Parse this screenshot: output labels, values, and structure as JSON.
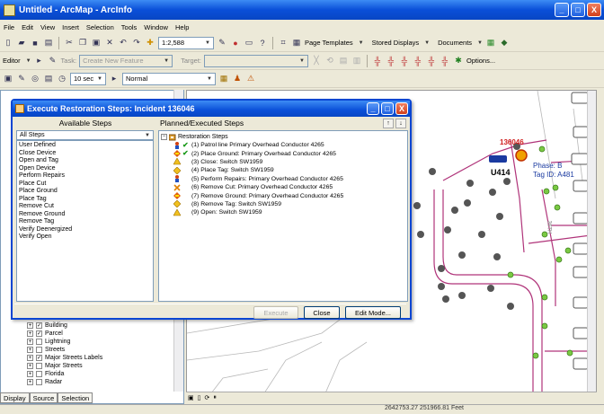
{
  "window": {
    "title": "Untitled - ArcMap - ArcInfo",
    "buttons": [
      "_",
      "□",
      "X"
    ]
  },
  "menu": [
    "File",
    "Edit",
    "View",
    "Insert",
    "Selection",
    "Tools",
    "Window",
    "Help"
  ],
  "toolbar1": {
    "scale": "1:2,588",
    "page_templates": "Page Templates",
    "stored_displays": "Stored Displays",
    "documents": "Documents"
  },
  "toolbar2": {
    "editor": "Editor",
    "task_label": "Task:",
    "task_value": "Create New Feature",
    "target_label": "Target:",
    "options": "Options..."
  },
  "toolbar3": {
    "interval": "10 sec",
    "mode": "Normal"
  },
  "toc": {
    "layers": [
      {
        "label": "Building",
        "checked": true
      },
      {
        "label": "Parcel",
        "checked": true
      },
      {
        "label": "Lightning",
        "checked": false
      },
      {
        "label": "Streets",
        "checked": false
      },
      {
        "label": "Major Streets Labels",
        "checked": true
      },
      {
        "label": "Major Streets",
        "checked": false
      },
      {
        "label": "Florida",
        "checked": false
      },
      {
        "label": "Radar",
        "checked": false
      }
    ],
    "tabs": [
      "Display",
      "Source",
      "Selection"
    ]
  },
  "dialog": {
    "title": "Execute Restoration Steps: Incident 136046",
    "available_label": "Available Steps",
    "planned_label": "Planned/Executed Steps",
    "steps_filter": "All Steps",
    "available_steps": [
      "User Defined",
      "Close Device",
      "Open and Tag",
      "Open Device",
      "Perform Repairs",
      "Place Cut",
      "Place Ground",
      "Place Tag",
      "Remove Cut",
      "Remove Ground",
      "Remove Tag",
      "Verify Deenergized",
      "Verify Open"
    ],
    "tree_root": "Restoration Steps",
    "planned_steps": [
      {
        "text": "(1) Patrol line Primary Overhead Conductor 4265",
        "done": true
      },
      {
        "text": "(2) Place Ground: Primary Overhead Conductor 4265",
        "done": true
      },
      {
        "text": "(3) Close: Switch SW1959",
        "done": false
      },
      {
        "text": "(4) Place Tag: Switch SW1959",
        "done": false
      },
      {
        "text": "(5) Perform Repairs: Primary Overhead Conductor 4265",
        "done": false
      },
      {
        "text": "(6) Remove Cut: Primary Overhead Conductor 4265",
        "done": false
      },
      {
        "text": "(7) Remove Ground: Primary Overhead Conductor 4265",
        "done": false
      },
      {
        "text": "(8) Remove Tag: Switch SW1959",
        "done": false
      },
      {
        "text": "(9) Open: Switch SW1959",
        "done": false
      }
    ],
    "buttons": {
      "execute": "Execute",
      "close": "Close",
      "edit": "Edit Mode..."
    }
  },
  "map": {
    "incident_id": "136046",
    "unit": "U414",
    "phase": "Phase: B",
    "tag": "Tag ID: A481",
    "street": "36TH"
  },
  "status": {
    "coords": "2642753.27  251966.81 Feet"
  },
  "colors": {
    "title_blue": "#0a4fd8",
    "road": "#b0347a",
    "incident_red": "#d02020",
    "node_green": "#7ac943"
  }
}
